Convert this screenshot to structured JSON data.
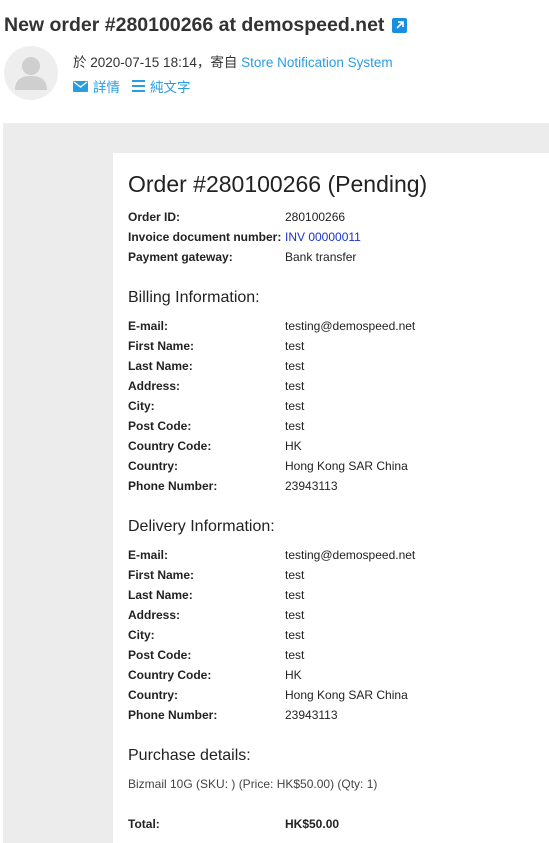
{
  "email": {
    "subject": "New order #280100266 at demospeed.net",
    "meta_prefix": "於 2020-07-15 18:14，寄自 ",
    "sender": "Store Notification System",
    "view_detail": "詳情",
    "view_plain": "純文字"
  },
  "order": {
    "title": "Order #280100266 (Pending)",
    "summary": [
      {
        "label": "Order ID:",
        "value": "280100266"
      },
      {
        "label": "Invoice document number:",
        "value": "INV 00000011"
      },
      {
        "label": "Payment gateway:",
        "value": "Bank transfer"
      }
    ],
    "billing_title": "Billing Information:",
    "billing": [
      {
        "label": "E-mail:",
        "value": "testing@demospeed.net"
      },
      {
        "label": "First Name:",
        "value": "test"
      },
      {
        "label": "Last Name:",
        "value": "test"
      },
      {
        "label": "Address:",
        "value": "test"
      },
      {
        "label": "City:",
        "value": "test"
      },
      {
        "label": "Post Code:",
        "value": "test"
      },
      {
        "label": "Country Code:",
        "value": "HK"
      },
      {
        "label": "Country:",
        "value": "Hong Kong SAR China"
      },
      {
        "label": "Phone Number:",
        "value": "23943113"
      }
    ],
    "delivery_title": "Delivery Information:",
    "delivery": [
      {
        "label": "E-mail:",
        "value": "testing@demospeed.net"
      },
      {
        "label": "First Name:",
        "value": "test"
      },
      {
        "label": "Last Name:",
        "value": "test"
      },
      {
        "label": "Address:",
        "value": "test"
      },
      {
        "label": "City:",
        "value": "test"
      },
      {
        "label": "Post Code:",
        "value": "test"
      },
      {
        "label": "Country Code:",
        "value": "HK"
      },
      {
        "label": "Country:",
        "value": "Hong Kong SAR China"
      },
      {
        "label": "Phone Number:",
        "value": "23943113"
      }
    ],
    "purchase_title": "Purchase details:",
    "purchase_line": "Bizmail 10G (SKU: ) (Price: HK$50.00) (Qty: 1)",
    "total_label": "Total:",
    "total_value": "HK$50.00"
  },
  "colors": {
    "link": "#2a9ce0",
    "invoice_link": "#1a33cc",
    "frame_bg": "#ececec"
  },
  "icons": {
    "open_external": "external-link-icon",
    "avatar": "user-avatar-icon",
    "detail": "envelope-icon",
    "plain": "list-lines-icon"
  }
}
